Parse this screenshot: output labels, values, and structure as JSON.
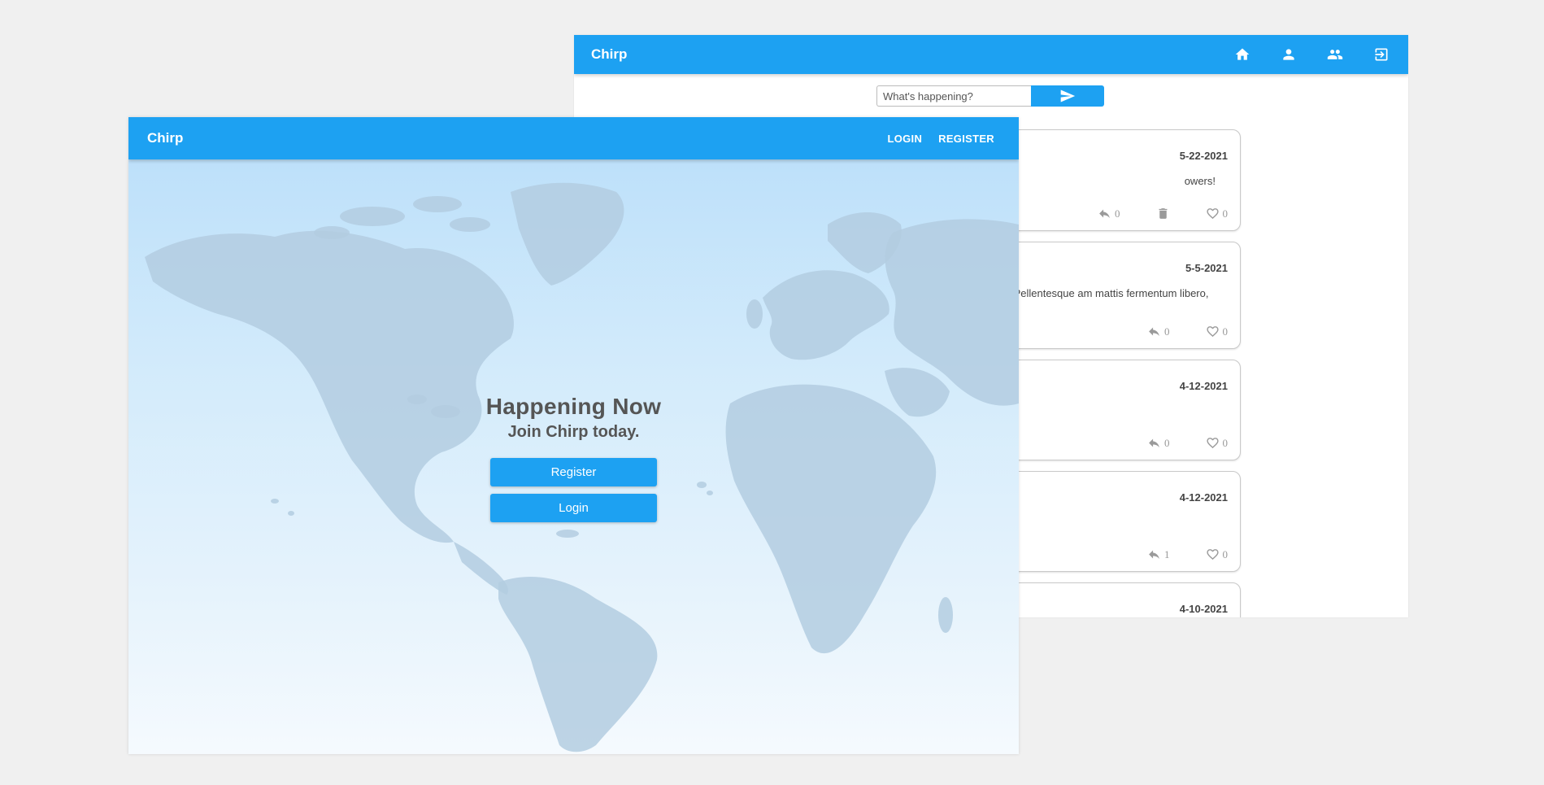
{
  "feed_window": {
    "brand": "Chirp",
    "nav_icons": [
      "home-icon",
      "person-icon",
      "people-icon",
      "logout-icon"
    ],
    "compose": {
      "placeholder": "What's happening?",
      "send_icon": "send-icon"
    },
    "posts": [
      {
        "date": "5-22-2021",
        "text": "owers!",
        "reply_count": "0",
        "like_count": "0",
        "has_delete": true
      },
      {
        "date": "5-5-2021",
        "text": "onsectetur adipiscing elit. Pellentesque am mattis fermentum libero, non",
        "reply_count": "0",
        "like_count": "0",
        "has_delete": false
      },
      {
        "date": "4-12-2021",
        "text": "",
        "reply_count": "0",
        "like_count": "0",
        "has_delete": false
      },
      {
        "date": "4-12-2021",
        "text": "",
        "reply_count": "1",
        "like_count": "0",
        "has_delete": false
      },
      {
        "date": "4-10-2021",
        "text": "",
        "reply_count": "",
        "like_count": "",
        "has_delete": false
      }
    ]
  },
  "landing_window": {
    "brand": "Chirp",
    "nav": {
      "login": "LOGIN",
      "register": "REGISTER"
    },
    "hero": {
      "title": "Happening Now",
      "subtitle": "Join Chirp today.",
      "register_button": "Register",
      "login_button": "Login"
    }
  },
  "colors": {
    "primary": "#1da1f2",
    "page_background": "#f0f0f0",
    "text_dark": "#555555"
  }
}
